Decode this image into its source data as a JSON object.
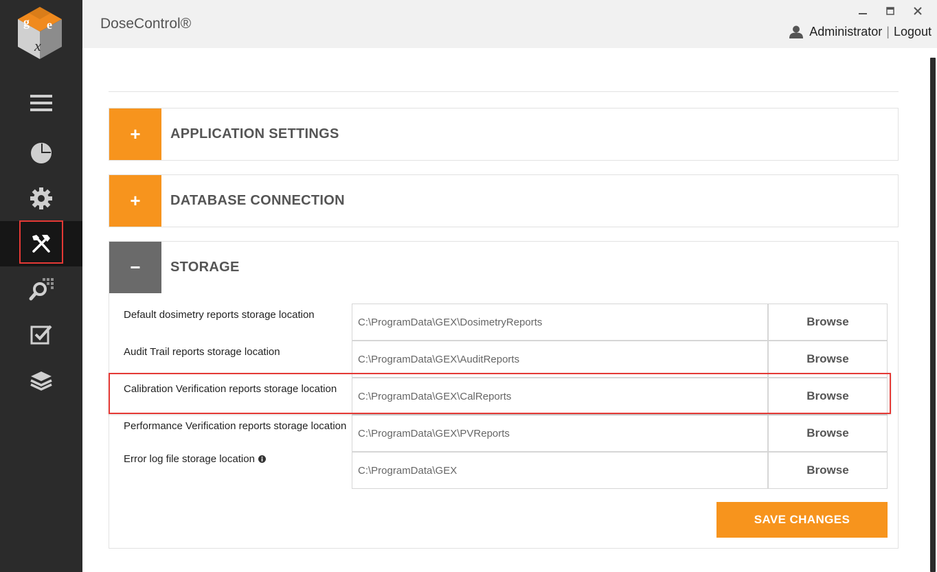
{
  "app": {
    "title": "DoseControl®",
    "logo_icon": "gex-cube-logo"
  },
  "header": {
    "user_icon": "user-icon",
    "user_name": "Administrator",
    "separator": "|",
    "logout_label": "Logout",
    "window_controls": [
      "minimize-icon",
      "maximize-icon",
      "close-icon"
    ]
  },
  "sidebar": {
    "items": [
      {
        "icon": "menu-icon"
      },
      {
        "icon": "dashboard-pie-icon"
      },
      {
        "icon": "gear-icon"
      },
      {
        "icon": "tools-icon",
        "active": true
      },
      {
        "icon": "search-grid-icon"
      },
      {
        "icon": "checkbox-icon"
      },
      {
        "icon": "layers-icon"
      }
    ]
  },
  "sections": {
    "application": {
      "toggle": "+",
      "title": "APPLICATION SETTINGS"
    },
    "database": {
      "toggle": "+",
      "title": "DATABASE CONNECTION"
    },
    "storage": {
      "toggle": "−",
      "title": "STORAGE",
      "rows": [
        {
          "label": "Default dosimetry reports storage location",
          "path": "C:\\ProgramData\\GEX\\DosimetryReports",
          "browse": "Browse"
        },
        {
          "label": "Audit Trail reports storage location",
          "path": "C:\\ProgramData\\GEX\\AuditReports",
          "browse": "Browse"
        },
        {
          "label": "Calibration Verification reports storage location",
          "path": "C:\\ProgramData\\GEX\\CalReports",
          "browse": "Browse"
        },
        {
          "label": "Performance Verification reports storage location",
          "path": "C:\\ProgramData\\GEX\\PVReports",
          "browse": "Browse"
        },
        {
          "label": "Error log file storage location",
          "path": "C:\\ProgramData\\GEX",
          "browse": "Browse",
          "info_icon": "info-icon"
        }
      ],
      "save_label": "SAVE CHANGES"
    }
  },
  "colors": {
    "accent": "#f7941d",
    "sidebar": "#2b2b2b",
    "highlight": "#e53935"
  }
}
